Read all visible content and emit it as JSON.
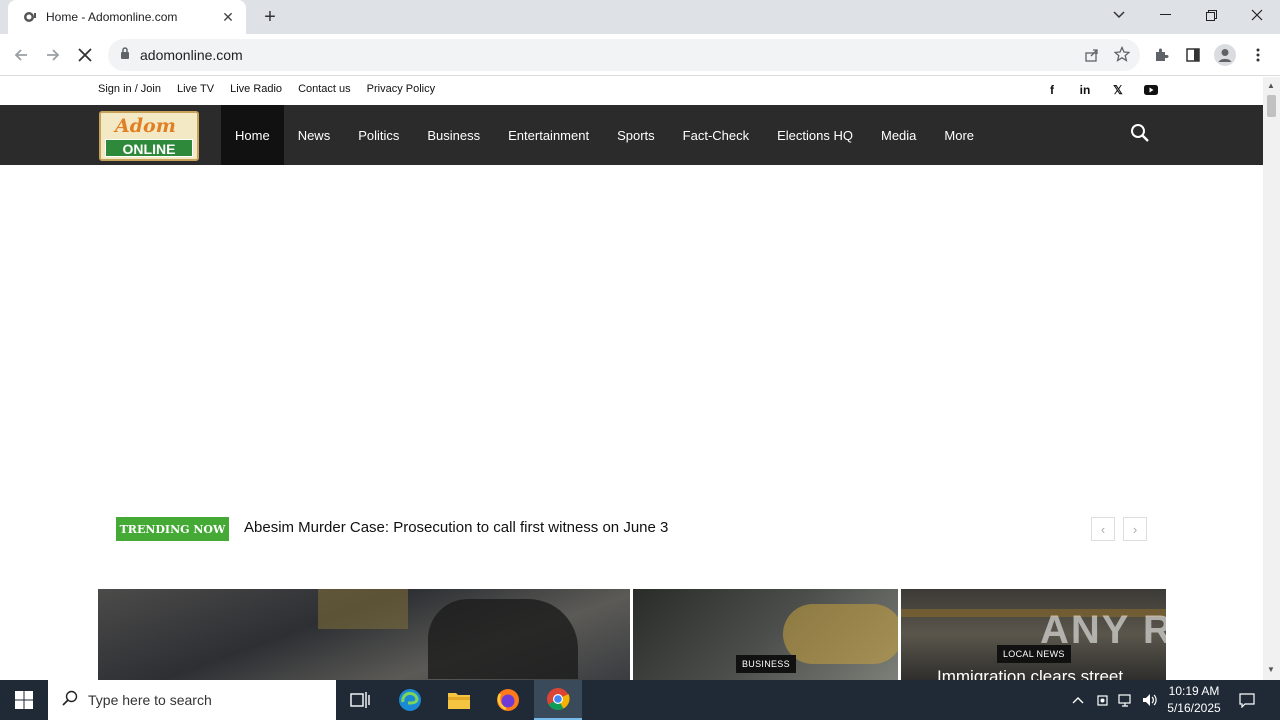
{
  "browser": {
    "tab_title": "Home - Adomonline.com",
    "url": "adomonline.com"
  },
  "site": {
    "top_links": [
      "Sign in / Join",
      "Live TV",
      "Live Radio",
      "Contact us",
      "Privacy Policy"
    ],
    "social_icons": [
      "facebook-icon",
      "linkedin-icon",
      "x-icon",
      "youtube-icon"
    ],
    "logo_line1": "Adom",
    "logo_line2": "ONLINE",
    "nav": [
      "Home",
      "News",
      "Politics",
      "Business",
      "Entertainment",
      "Sports",
      "Fact-Check",
      "Elections HQ",
      "Media",
      "More"
    ],
    "active_nav": "Home",
    "trending_label": "TRENDING NOW",
    "trending_headline": "Abesim Murder Case: Prosecution to call first witness on June 3",
    "stories": [
      {
        "category": ""
      },
      {
        "category": "BUSINESS"
      },
      {
        "category": "LOCAL NEWS",
        "title": "Immigration clears street"
      }
    ]
  },
  "watermark": "ANY RUN",
  "taskbar": {
    "search_placeholder": "Type here to search",
    "time": "10:19 AM",
    "date": "5/16/2025"
  },
  "colors": {
    "nav_bg": "#2b2b2b",
    "trending_green": "#45a935",
    "taskbar_bg": "#1f2a36"
  }
}
